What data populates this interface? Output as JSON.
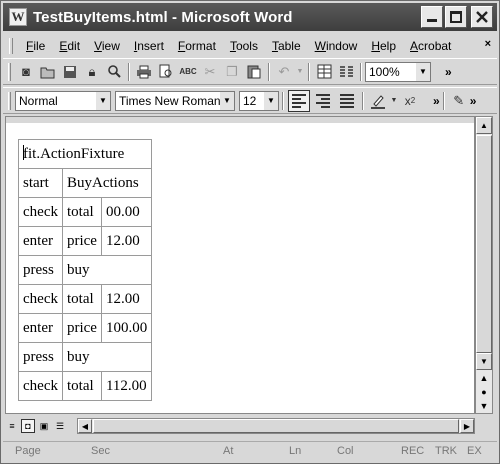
{
  "window": {
    "title": "TestBuyItems.html - Microsoft Word"
  },
  "menu": {
    "items": [
      "File",
      "Edit",
      "View",
      "Insert",
      "Format",
      "Tools",
      "Table",
      "Window",
      "Help",
      "Acrobat"
    ],
    "more": "×"
  },
  "toolbar_standard": {
    "zoom": "100%"
  },
  "toolbar_formatting": {
    "style": "Normal",
    "font": "Times New Roman",
    "size": "12"
  },
  "document": {
    "table": [
      [
        "fit.ActionFixture"
      ],
      [
        "start",
        "BuyActions"
      ],
      [
        "check",
        "total",
        "00.00"
      ],
      [
        "enter",
        "price",
        "12.00"
      ],
      [
        "press",
        "buy"
      ],
      [
        "check",
        "total",
        "12.00"
      ],
      [
        "enter",
        "price",
        "100.00"
      ],
      [
        "press",
        "buy"
      ],
      [
        "check",
        "total",
        "112.00"
      ]
    ]
  },
  "statusbar": {
    "page": "Page",
    "sec": "Sec",
    "at": "At",
    "ln": "Ln",
    "col": "Col",
    "rec": "REC",
    "trk": "TRK",
    "ext": "EX"
  }
}
